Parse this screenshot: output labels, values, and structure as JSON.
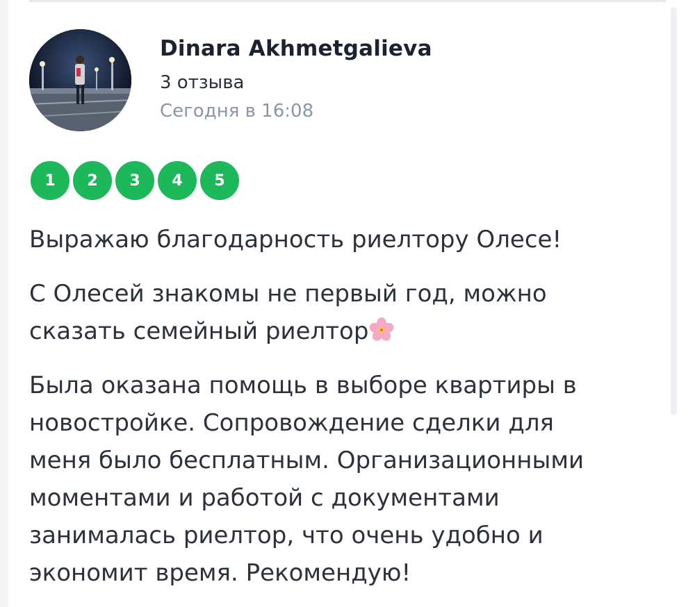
{
  "review": {
    "author": "Dinara Akhmetgalieva",
    "review_count": "3 отзыва",
    "date": "Сегодня в 16:08",
    "rating_labels": [
      "1",
      "2",
      "3",
      "4",
      "5"
    ],
    "rating": 5,
    "paragraph_1": "Выражаю благодарность риелтору Олесе!",
    "paragraph_2_line_1": "С Олесей знакомы не первый год, можно",
    "paragraph_2_line_2": "сказать семейный риелтор",
    "paragraph_2_emoji": "cherry-blossom-icon",
    "paragraph_3_lines": [
      "Была оказана помощь в выборе квартиры в",
      "новостройке. Сопровождение сделки для",
      "меня было бесплатным. Организационными",
      "моментами и работой с документами",
      "занималась риелтор, что очень удобно и",
      "экономит время. Рекомендую!"
    ]
  },
  "colors": {
    "rating_green": "#1cb85a",
    "name_text": "#1c2330",
    "date_text": "#8a96a8",
    "body_text": "#2c313b"
  }
}
